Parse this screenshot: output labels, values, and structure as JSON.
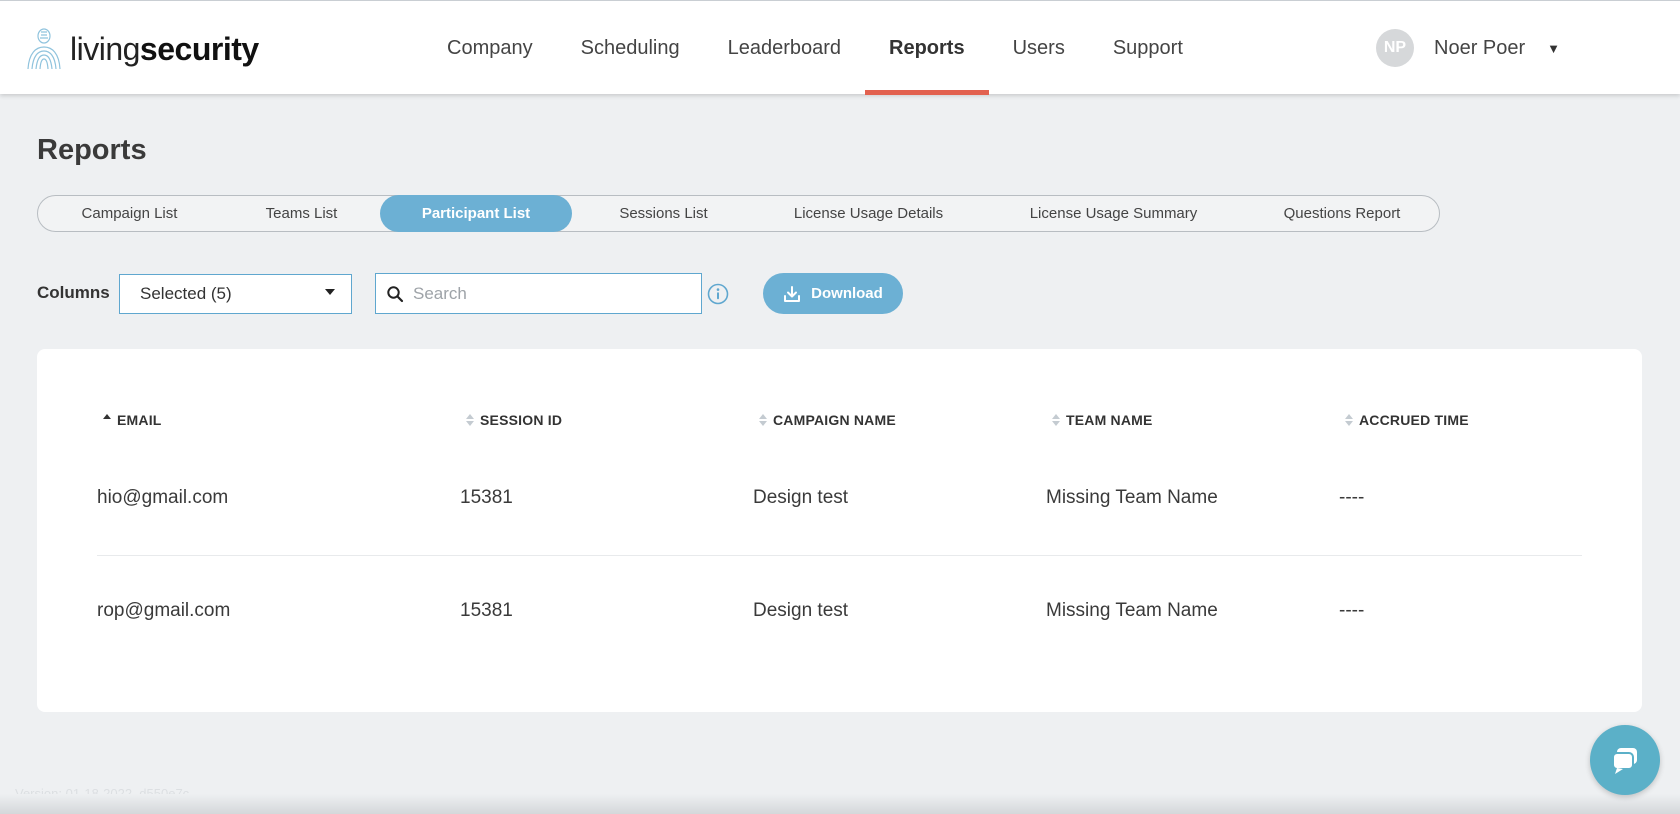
{
  "brand": {
    "name_light": "living",
    "name_bold": "security"
  },
  "nav": {
    "items": [
      {
        "label": "Company"
      },
      {
        "label": "Scheduling"
      },
      {
        "label": "Leaderboard"
      },
      {
        "label": "Reports",
        "active": true
      },
      {
        "label": "Users"
      },
      {
        "label": "Support"
      }
    ]
  },
  "user": {
    "initials": "NP",
    "name": "Noer Poer",
    "caret": "▼"
  },
  "page": {
    "title": "Reports"
  },
  "tabs": [
    {
      "label": "Campaign List"
    },
    {
      "label": "Teams List"
    },
    {
      "label": "Participant List",
      "active": true
    },
    {
      "label": "Sessions List"
    },
    {
      "label": "License Usage Details"
    },
    {
      "label": "License Usage Summary"
    },
    {
      "label": "Questions Report"
    }
  ],
  "toolbar": {
    "columns_label": "Columns",
    "columns_value": "Selected (5)",
    "search_placeholder": "Search",
    "search_value": "",
    "download_label": "Download"
  },
  "table": {
    "headers": [
      "EMAIL",
      "SESSION ID",
      "CAMPAIGN NAME",
      "TEAM NAME",
      "ACCRUED TIME"
    ],
    "sorted_column": "EMAIL",
    "rows": [
      [
        "hio@gmail.com",
        "15381",
        "Design test",
        "Missing Team Name",
        "----"
      ],
      [
        "rop@gmail.com",
        "15381",
        "Design test",
        "Missing Team Name",
        "----"
      ]
    ]
  },
  "footer": {
    "version": "Version: 01-18-2022, d550e7c"
  },
  "colors": {
    "accent": "#6cb0d4",
    "active_nav_underline": "#e2614f",
    "chat_button": "#5bb0c8",
    "background": "#eef0f2"
  },
  "icons": [
    "logo-figure-icon",
    "chevron-down-icon",
    "search-icon",
    "info-icon",
    "download-icon",
    "chat-icon",
    "sort-icon"
  ]
}
